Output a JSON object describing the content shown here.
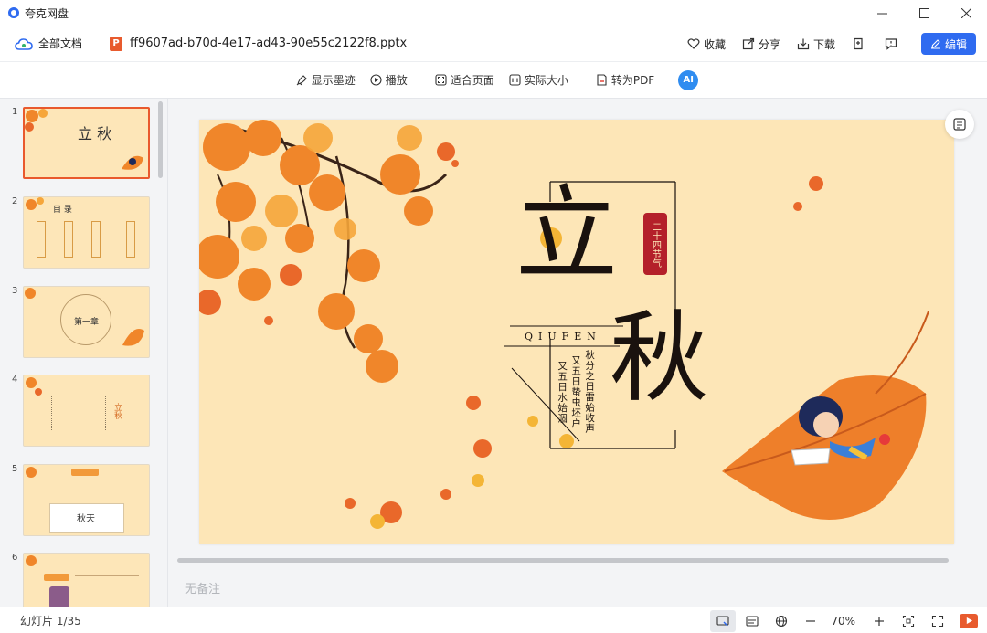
{
  "app": {
    "title": "夸克网盘"
  },
  "header": {
    "all_docs": "全部文档",
    "file_icon": "P",
    "filename": "ff9607ad-b70d-4e17-ad43-90e55c2122f8.pptx",
    "favorite": "收藏",
    "share": "分享",
    "download": "下载",
    "edit": "编辑"
  },
  "toolbar": {
    "ink": "显示墨迹",
    "play": "播放",
    "fit_page": "适合页面",
    "actual_size": "实际大小",
    "to_pdf": "转为PDF",
    "ai": "AI"
  },
  "thumbnails": [
    {
      "num": "1",
      "text": "立 秋"
    },
    {
      "num": "2",
      "text": "目 录"
    },
    {
      "num": "3",
      "text": "第一章"
    },
    {
      "num": "4",
      "text": "立秋"
    },
    {
      "num": "5",
      "text": "秋天"
    },
    {
      "num": "6",
      "text": ""
    }
  ],
  "slide": {
    "char_li": "立",
    "char_qiu": "秋",
    "seal": "二十四节气",
    "pinyin": "QIUFEN",
    "poem_col1": "秋分之日雷始收声",
    "poem_col2": "又五日蛰虫坯户",
    "poem_col3": "又五日水始涸"
  },
  "notes": {
    "placeholder": "无备注"
  },
  "status": {
    "slide_count": "幻灯片 1/35",
    "zoom": "70%"
  },
  "colors": {
    "accent": "#2f6bf0",
    "slide_bg": "#fde6b7",
    "leaf": "#f0862a",
    "seal": "#b4202a"
  }
}
